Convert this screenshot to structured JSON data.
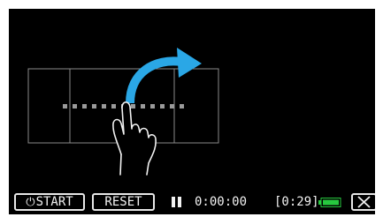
{
  "toolbar": {
    "start_icon": "power-timer-icon",
    "start_label": "START",
    "reset_label": "RESET",
    "pause_icon": "pause-icon",
    "elapsed_time": "0:00:00",
    "remaining_time": "[0:29]",
    "battery_icon": "battery-icon",
    "battery_level": 1.0,
    "close_icon": "close-icon"
  },
  "illustration": {
    "description_icon": "swipe-hand-icon",
    "arrow_icon": "curved-arrow-right-icon",
    "dot_count": 13
  },
  "colors": {
    "background": "#000000",
    "arrow": "#2aa7e6",
    "battery": "#27c93f",
    "text": "#f2f2f2",
    "frame_lines": "#8a8a8a",
    "dots": "#9a9a9a"
  }
}
